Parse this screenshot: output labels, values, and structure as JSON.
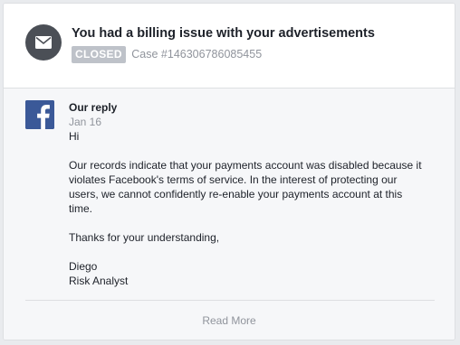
{
  "header": {
    "title": "You had a billing issue with your advertisements",
    "status_badge": "CLOSED",
    "case_number": "Case #146306786085455",
    "avatar_icon": "envelope-icon"
  },
  "reply": {
    "logo_icon": "facebook-logo-icon",
    "heading": "Our reply",
    "date": "Jan 16",
    "greeting": "Hi",
    "paragraph_lines": [
      "Our records indicate that your payments account was disabled because it",
      "violates Facebook's terms of service. In the interest of protecting our",
      "users, we cannot confidently re-enable your payments account at this",
      "time."
    ],
    "thanks": "Thanks for your understanding,",
    "signature_name": "Diego",
    "signature_title": "Risk Analyst"
  },
  "footer": {
    "read_more_label": "Read More"
  },
  "colors": {
    "page_background": "#e9ebee",
    "card_background": "#ffffff",
    "body_background": "#f6f7f9",
    "facebook_blue": "#3b5998",
    "avatar_gray": "#4b4f56",
    "badge_gray": "#bec2c9",
    "muted_text": "#90949c",
    "primary_text": "#1d2129"
  }
}
